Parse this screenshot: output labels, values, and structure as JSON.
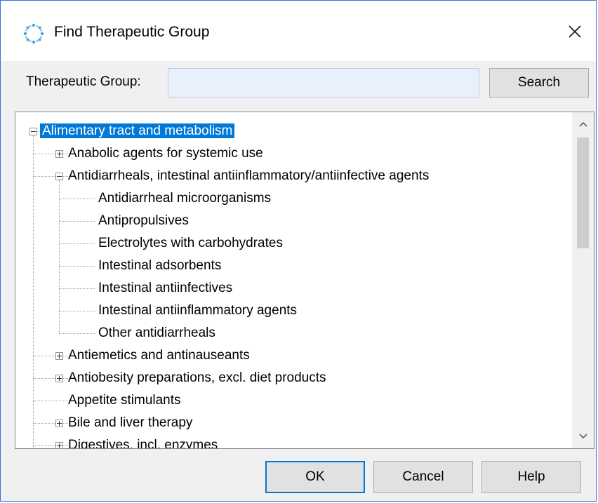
{
  "window": {
    "title": "Find Therapeutic Group",
    "icon": "molecule-icon",
    "close_icon": "close-icon"
  },
  "search": {
    "label": "Therapeutic Group:",
    "value": "",
    "placeholder": "",
    "button_label": "Search"
  },
  "tree": {
    "nodes": [
      {
        "label": "Alimentary tract and metabolism",
        "level": 0,
        "expander": "minus",
        "selected": true
      },
      {
        "label": "Anabolic agents for systemic use",
        "level": 1,
        "expander": "plus"
      },
      {
        "label": "Antidiarrheals, intestinal antiinflammatory/antiinfective agents",
        "level": 1,
        "expander": "minus"
      },
      {
        "label": "Antidiarrheal microorganisms",
        "level": 2,
        "expander": "none"
      },
      {
        "label": "Antipropulsives",
        "level": 2,
        "expander": "none"
      },
      {
        "label": "Electrolytes with carbohydrates",
        "level": 2,
        "expander": "none"
      },
      {
        "label": "Intestinal adsorbents",
        "level": 2,
        "expander": "none"
      },
      {
        "label": "Intestinal antiinfectives",
        "level": 2,
        "expander": "none"
      },
      {
        "label": "Intestinal antiinflammatory agents",
        "level": 2,
        "expander": "none"
      },
      {
        "label": "Other antidiarrheals",
        "level": 2,
        "expander": "none"
      },
      {
        "label": "Antiemetics and antinauseants",
        "level": 1,
        "expander": "plus"
      },
      {
        "label": "Antiobesity preparations, excl. diet products",
        "level": 1,
        "expander": "plus"
      },
      {
        "label": "Appetite stimulants",
        "level": 1,
        "expander": "none"
      },
      {
        "label": "Bile and liver therapy",
        "level": 1,
        "expander": "plus"
      },
      {
        "label": "Digestives, incl. enzymes",
        "level": 1,
        "expander": "plus"
      }
    ],
    "scroll_up_icon": "chevron-up-icon",
    "scroll_down_icon": "chevron-down-icon"
  },
  "footer": {
    "ok_label": "OK",
    "cancel_label": "Cancel",
    "help_label": "Help"
  },
  "colors": {
    "selection": "#0078d7",
    "window_border": "#2b79d8",
    "input_bg": "#e7f0fb"
  }
}
